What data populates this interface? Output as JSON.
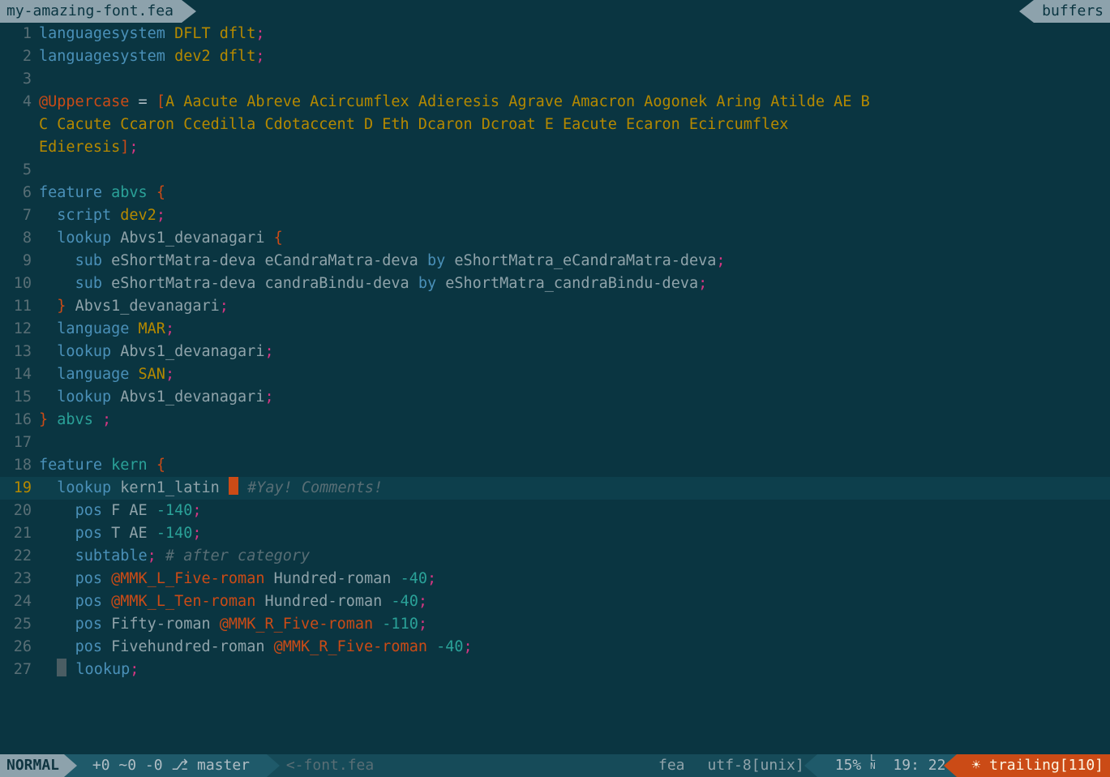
{
  "top": {
    "filename": "my-amazing-font.fea",
    "buffers": "buffers"
  },
  "lines": [
    {
      "n": 1,
      "html": "<span class='kw'>languagesystem</span> <span class='gold'>DFLT</span> <span class='gold'>dflt</span><span class='punct'>;</span>"
    },
    {
      "n": 2,
      "html": "<span class='kw'>languagesystem</span> <span class='gold'>dev2</span> <span class='gold'>dflt</span><span class='punct'>;</span>"
    },
    {
      "n": 3,
      "html": ""
    },
    {
      "n": 4,
      "html": "<span class='class'>@Uppercase</span> <span class='assign'>=</span> <span class='bracket'>[</span><span class='gold'>A Aacute Abreve Acircumflex Adieresis Agrave Amacron Aogonek Aring Atilde AE B</span>"
    },
    {
      "n": "",
      "html": "<span class='gold'>C Cacute Ccaron Ccedilla Cdotaccent D Eth Dcaron Dcroat E Eacute Ecaron Ecircumflex</span>"
    },
    {
      "n": "",
      "html": "<span class='gold'>Edieresis</span><span class='bracket'>]</span><span class='punct'>;</span>"
    },
    {
      "n": 5,
      "html": ""
    },
    {
      "n": 6,
      "html": "<span class='kw'>feature</span> <span class='lit'>abvs</span> <span class='brace'>{</span>"
    },
    {
      "n": 7,
      "html": "&nbsp; <span class='kw'>script</span> <span class='gold'>dev2</span><span class='punct'>;</span>"
    },
    {
      "n": 8,
      "html": "&nbsp; <span class='kw'>lookup</span> <span class='text'>Abvs1_devanagari</span> <span class='brace'>{</span>"
    },
    {
      "n": 9,
      "html": "&nbsp; &nbsp; <span class='kw'>sub</span> <span class='text'>eShortMatra-deva eCandraMatra-deva</span> <span class='kw'>by</span> <span class='text'>eShortMatra_eCandraMatra-deva</span><span class='punct'>;</span>"
    },
    {
      "n": 10,
      "html": "&nbsp; &nbsp; <span class='kw'>sub</span> <span class='text'>eShortMatra-deva candraBindu-deva</span> <span class='kw'>by</span> <span class='text'>eShortMatra_candraBindu-deva</span><span class='punct'>;</span>"
    },
    {
      "n": 11,
      "html": "&nbsp; <span class='brace'>}</span> <span class='text'>Abvs1_devanagari</span><span class='punct'>;</span>"
    },
    {
      "n": 12,
      "html": "&nbsp; <span class='kw'>language</span> <span class='gold'>MAR</span><span class='punct'>;</span>"
    },
    {
      "n": 13,
      "html": "&nbsp; <span class='kw'>lookup</span> <span class='text'>Abvs1_devanagari</span><span class='punct'>;</span>"
    },
    {
      "n": 14,
      "html": "&nbsp; <span class='kw'>language</span> <span class='gold'>SAN</span><span class='punct'>;</span>"
    },
    {
      "n": 15,
      "html": "&nbsp; <span class='kw'>lookup</span> <span class='text'>Abvs1_devanagari</span><span class='punct'>;</span>"
    },
    {
      "n": 16,
      "html": "<span class='brace'>}</span> <span class='lit'>abvs</span> <span class='punct'>;</span>"
    },
    {
      "n": 17,
      "html": ""
    },
    {
      "n": 18,
      "html": "<span class='kw'>feature</span> <span class='lit'>kern</span> <span class='brace'>{</span>"
    },
    {
      "n": 19,
      "html": "&nbsp; <span class='kw'>lookup</span> <span class='text'>kern1_latin</span> <span class='cursor'></span> <span class='comment'>#Yay! Comments!</span>",
      "hl": true
    },
    {
      "n": 20,
      "html": "&nbsp; &nbsp; <span class='kw'>pos</span> <span class='text'>F AE</span> <span class='num'>-140</span><span class='punct'>;</span>"
    },
    {
      "n": 21,
      "html": "&nbsp; &nbsp; <span class='kw'>pos</span> <span class='text'>T AE</span> <span class='num'>-140</span><span class='punct'>;</span>"
    },
    {
      "n": 22,
      "html": "&nbsp; &nbsp; <span class='kw'>subtable</span><span class='punct'>;</span> <span class='comment'># after category</span>"
    },
    {
      "n": 23,
      "html": "&nbsp; &nbsp; <span class='kw'>pos</span> <span class='class'>@MMK_L_Five-roman</span> <span class='text'>Hundred-roman</span> <span class='num'>-40</span><span class='punct'>;</span>"
    },
    {
      "n": 24,
      "html": "&nbsp; &nbsp; <span class='kw'>pos</span> <span class='class'>@MMK_L_Ten-roman</span> <span class='text'>Hundred-roman</span> <span class='num'>-40</span><span class='punct'>;</span>"
    },
    {
      "n": 25,
      "html": "&nbsp; &nbsp; <span class='kw'>pos</span> <span class='text'>Fifty-roman</span> <span class='class'>@MMK_R_Five-roman</span> <span class='num'>-110</span><span class='punct'>;</span>"
    },
    {
      "n": 26,
      "html": "&nbsp; &nbsp; <span class='kw'>pos</span> <span class='text'>Fivehundred-roman</span> <span class='class'>@MMK_R_Five-roman</span> <span class='num'>-40</span><span class='punct'>;</span>"
    },
    {
      "n": 27,
      "html": "&nbsp; <span class='whitespace'></span> <span class='kw'>lookup</span><span class='punct'>;</span>"
    }
  ],
  "status": {
    "mode": "NORMAL",
    "git": " +0 ~0 -0 ⎇ master ",
    "file": "<-font.fea",
    "filetype": "fea",
    "encoding": "utf-8[unix]",
    "percent": "15%",
    "linecol": "19: 22",
    "trailing": "☀ trailing[110]"
  },
  "current_line": 19
}
